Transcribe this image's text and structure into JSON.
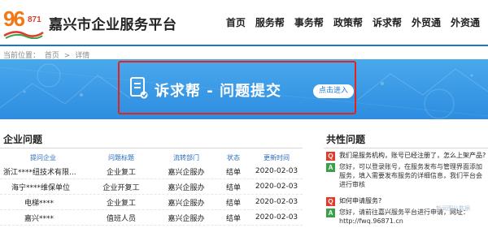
{
  "header": {
    "logo_main": "96",
    "logo_sub": "871",
    "title": "嘉兴市企业服务平台",
    "nav": [
      "首页",
      "服务帮",
      "事务帮",
      "政策帮",
      "诉求帮",
      "外贸通",
      "外资通"
    ]
  },
  "breadcrumb": {
    "prefix": "当前位置：",
    "home": "首页",
    "separator": ">",
    "current": "详情"
  },
  "banner": {
    "title": "诉求帮 - 问题提交",
    "button": "点击进入"
  },
  "enterprise_problems": {
    "title": "企业问题",
    "columns": [
      "提问企业",
      "问题标题",
      "流转部门",
      "状态",
      "更新时间"
    ],
    "rows": [
      {
        "company": "浙江****纽技术有限...",
        "topic": "企业复工",
        "dept": "嘉兴企服办",
        "status": "结单",
        "time": "2020-02-03"
      },
      {
        "company": "海宁****维保单位",
        "topic": "企业开复工",
        "dept": "嘉兴企服办",
        "status": "结单",
        "time": "2020-02-03"
      },
      {
        "company": "电梯****",
        "topic": "企业复工",
        "dept": "嘉兴企服办",
        "status": "结单",
        "time": "2020-02-03"
      },
      {
        "company": "嘉兴****",
        "topic": "值班人员",
        "dept": "嘉兴企服办",
        "status": "结单",
        "time": "2020-02-03"
      }
    ]
  },
  "faq": {
    "title": "共性问题",
    "items": [
      {
        "type": "Q",
        "text": "我们是服务机构，账号已经注册了，怎么上架产品?"
      },
      {
        "type": "A",
        "text": "您好，可以登录账号，在服务发布与管理界面添加服务，填入需要发布服务的详细信息，我们平台会进行审核"
      },
      {
        "type": "Q",
        "text": "如何申请服务?"
      },
      {
        "type": "A",
        "text": "您好，请前往嘉兴服务平台进行申请，网址：http://fwq.96871.cn"
      }
    ]
  },
  "watermark": "新闻图片数据",
  "colors": {
    "brand_blue": "#1677c9",
    "banner_blue": "#2d8de0",
    "highlight_red": "#e5231c",
    "logo_orange": "#f07a17",
    "q_red": "#e23b2b",
    "a_green": "#3aa14a"
  }
}
